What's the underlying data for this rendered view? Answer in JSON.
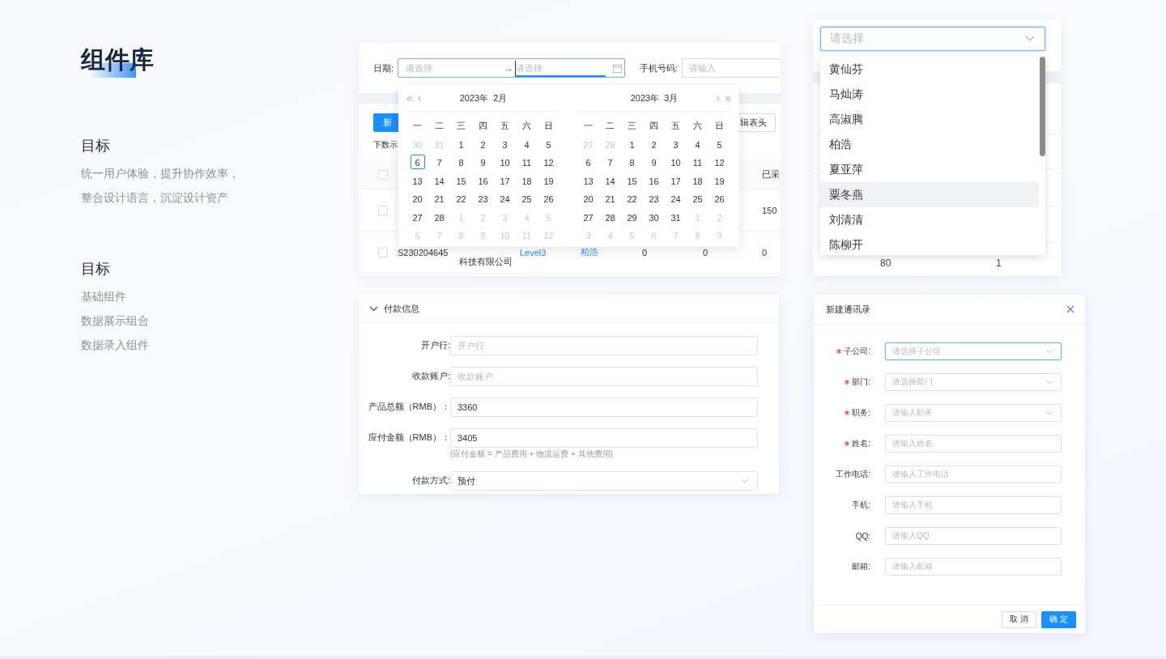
{
  "intro": {
    "title": "组件库",
    "sections": [
      {
        "heading": "目标",
        "lines": [
          "统一用户体验，提升协作效率，",
          "整合设计语言，沉淀设计资产"
        ]
      },
      {
        "heading": "目标",
        "lines": [
          "基础组件",
          "数据展示组合",
          "数据录入组件"
        ]
      }
    ]
  },
  "filter": {
    "date_label": "日期:",
    "start_placeholder": "请选择",
    "separator": "→",
    "end_placeholder": "请选择",
    "phone_label": "手机号码:",
    "phone_placeholder": "请输入"
  },
  "table": {
    "new_button": "新",
    "edit_header_button": "辑表头",
    "caption": "下数示",
    "header_checked": false,
    "columns": [
      "已采"
    ],
    "rows": [
      {
        "checked": false,
        "cells": [
          {
            "text": "150",
            "kind": "text"
          }
        ]
      },
      {
        "checked": false,
        "cells": [
          {
            "text": "S230204645",
            "kind": "text"
          },
          {
            "text": "科技有限公司",
            "kind": "text"
          },
          {
            "text": "Level3",
            "kind": "link"
          },
          {
            "text": "柏浩",
            "kind": "link"
          },
          {
            "text": "0",
            "kind": "text"
          },
          {
            "text": "0",
            "kind": "text"
          },
          {
            "text": "0",
            "kind": "number"
          }
        ]
      }
    ]
  },
  "calendars": [
    {
      "title": "2023年  2月",
      "nav": [
        "«",
        "‹"
      ],
      "weekdays": [
        "一",
        "二",
        "三",
        "四",
        "五",
        "六",
        "日"
      ],
      "weeks": [
        [
          {
            "day": "30",
            "other_month": true,
            "selected": false
          },
          {
            "day": "31",
            "other_month": true,
            "selected": false
          },
          {
            "day": "1",
            "other_month": false,
            "selected": false
          },
          {
            "day": "2",
            "other_month": false,
            "selected": false
          },
          {
            "day": "3",
            "other_month": false,
            "selected": false
          },
          {
            "day": "4",
            "other_month": false,
            "selected": false
          },
          {
            "day": "5",
            "other_month": false,
            "selected": false
          }
        ],
        [
          {
            "day": "6",
            "other_month": false,
            "selected": true
          },
          {
            "day": "7",
            "other_month": false,
            "selected": false
          },
          {
            "day": "8",
            "other_month": false,
            "selected": false
          },
          {
            "day": "9",
            "other_month": false,
            "selected": false
          },
          {
            "day": "10",
            "other_month": false,
            "selected": false
          },
          {
            "day": "11",
            "other_month": false,
            "selected": false
          },
          {
            "day": "12",
            "other_month": false,
            "selected": false
          }
        ],
        [
          {
            "day": "13",
            "other_month": false,
            "selected": false
          },
          {
            "day": "14",
            "other_month": false,
            "selected": false
          },
          {
            "day": "15",
            "other_month": false,
            "selected": false
          },
          {
            "day": "16",
            "other_month": false,
            "selected": false
          },
          {
            "day": "17",
            "other_month": false,
            "selected": false
          },
          {
            "day": "18",
            "other_month": false,
            "selected": false
          },
          {
            "day": "19",
            "other_month": false,
            "selected": false
          }
        ],
        [
          {
            "day": "20",
            "other_month": false,
            "selected": false
          },
          {
            "day": "21",
            "other_month": false,
            "selected": false
          },
          {
            "day": "22",
            "other_month": false,
            "selected": false
          },
          {
            "day": "23",
            "other_month": false,
            "selected": false
          },
          {
            "day": "24",
            "other_month": false,
            "selected": false
          },
          {
            "day": "25",
            "other_month": false,
            "selected": false
          },
          {
            "day": "26",
            "other_month": false,
            "selected": false
          }
        ],
        [
          {
            "day": "27",
            "other_month": false,
            "selected": false
          },
          {
            "day": "28",
            "other_month": false,
            "selected": false
          },
          {
            "day": "1",
            "other_month": true,
            "selected": false
          },
          {
            "day": "2",
            "other_month": true,
            "selected": false
          },
          {
            "day": "3",
            "other_month": true,
            "selected": false
          },
          {
            "day": "4",
            "other_month": true,
            "selected": false
          },
          {
            "day": "5",
            "other_month": true,
            "selected": false
          }
        ],
        [
          {
            "day": "6",
            "other_month": true,
            "selected": false
          },
          {
            "day": "7",
            "other_month": true,
            "selected": false
          },
          {
            "day": "8",
            "other_month": true,
            "selected": false
          },
          {
            "day": "9",
            "other_month": true,
            "selected": false
          },
          {
            "day": "10",
            "other_month": true,
            "selected": false
          },
          {
            "day": "11",
            "other_month": true,
            "selected": false
          },
          {
            "day": "12",
            "other_month": true,
            "selected": false
          }
        ]
      ]
    },
    {
      "title": "2023年  3月",
      "nav": [
        "›",
        "»"
      ],
      "weekdays": [
        "一",
        "二",
        "三",
        "四",
        "五",
        "六",
        "日"
      ],
      "weeks": [
        [
          {
            "day": "27",
            "other_month": true,
            "selected": false
          },
          {
            "day": "28",
            "other_month": true,
            "selected": false
          },
          {
            "day": "1",
            "other_month": false,
            "selected": false
          },
          {
            "day": "2",
            "other_month": false,
            "selected": false
          },
          {
            "day": "3",
            "other_month": false,
            "selected": false
          },
          {
            "day": "4",
            "other_month": false,
            "selected": false
          },
          {
            "day": "5",
            "other_month": false,
            "selected": false
          }
        ],
        [
          {
            "day": "6",
            "other_month": false,
            "selected": false
          },
          {
            "day": "7",
            "other_month": false,
            "selected": false
          },
          {
            "day": "8",
            "other_month": false,
            "selected": false
          },
          {
            "day": "9",
            "other_month": false,
            "selected": false
          },
          {
            "day": "10",
            "other_month": false,
            "selected": false
          },
          {
            "day": "11",
            "other_month": false,
            "selected": false
          },
          {
            "day": "12",
            "other_month": false,
            "selected": false
          }
        ],
        [
          {
            "day": "13",
            "other_month": false,
            "selected": false
          },
          {
            "day": "14",
            "other_month": false,
            "selected": false
          },
          {
            "day": "15",
            "other_month": false,
            "selected": false
          },
          {
            "day": "16",
            "other_month": false,
            "selected": false
          },
          {
            "day": "17",
            "other_month": false,
            "selected": false
          },
          {
            "day": "18",
            "other_month": false,
            "selected": false
          },
          {
            "day": "19",
            "other_month": false,
            "selected": false
          }
        ],
        [
          {
            "day": "20",
            "other_month": false,
            "selected": false
          },
          {
            "day": "21",
            "other_month": false,
            "selected": false
          },
          {
            "day": "22",
            "other_month": false,
            "selected": false
          },
          {
            "day": "23",
            "other_month": false,
            "selected": false
          },
          {
            "day": "24",
            "other_month": false,
            "selected": false
          },
          {
            "day": "25",
            "other_month": false,
            "selected": false
          },
          {
            "day": "26",
            "other_month": false,
            "selected": false
          }
        ],
        [
          {
            "day": "27",
            "other_month": false,
            "selected": false
          },
          {
            "day": "28",
            "other_month": false,
            "selected": false
          },
          {
            "day": "29",
            "other_month": false,
            "selected": false
          },
          {
            "day": "30",
            "other_month": false,
            "selected": false
          },
          {
            "day": "31",
            "other_month": false,
            "selected": false
          },
          {
            "day": "1",
            "other_month": true,
            "selected": false
          },
          {
            "day": "2",
            "other_month": true,
            "selected": false
          }
        ],
        [
          {
            "day": "3",
            "other_month": true,
            "selected": false
          },
          {
            "day": "4",
            "other_month": true,
            "selected": false
          },
          {
            "day": "5",
            "other_month": true,
            "selected": false
          },
          {
            "day": "6",
            "other_month": true,
            "selected": false
          },
          {
            "day": "7",
            "other_month": true,
            "selected": false
          },
          {
            "day": "8",
            "other_month": true,
            "selected": false
          },
          {
            "day": "9",
            "other_month": true,
            "selected": false
          }
        ]
      ]
    }
  ],
  "select": {
    "placeholder": "请选择",
    "options": [
      {
        "label": "黄仙芬",
        "highlighted": false
      },
      {
        "label": "马灿涛",
        "highlighted": false
      },
      {
        "label": "高淑腾",
        "highlighted": false
      },
      {
        "label": "柏浩",
        "highlighted": false
      },
      {
        "label": "夏亚萍",
        "highlighted": false
      },
      {
        "label": "粟冬燕",
        "highlighted": true
      },
      {
        "label": "刘清清",
        "highlighted": false
      },
      {
        "label": "陈柳开",
        "highlighted": false
      }
    ],
    "behind_cells": [
      "80",
      "1"
    ]
  },
  "payment": {
    "title": "付款信息",
    "expanded": true,
    "fields": [
      {
        "label": "开户行:",
        "kind": "input",
        "placeholder": "开户行"
      },
      {
        "label": "收款账户:",
        "kind": "input",
        "placeholder": "收款账户"
      },
      {
        "label": "产品总额（RMB）：",
        "kind": "input",
        "value": "3360"
      },
      {
        "label": "应付金额（RMB）：",
        "kind": "input",
        "value": "3405",
        "hint": "(应付金额 = 产品费用 + 物流运费 + 其他费用)"
      },
      {
        "label": "付款方式:",
        "kind": "select",
        "value": "预付"
      }
    ]
  },
  "dialog": {
    "title": "新建通讯录",
    "fields": [
      {
        "label": "子公司:",
        "required": true,
        "kind": "select",
        "placeholder": "请选择子公司",
        "focused": true
      },
      {
        "label": "部门:",
        "required": true,
        "kind": "select",
        "placeholder": "请选择部门",
        "focused": false
      },
      {
        "label": "职务:",
        "required": true,
        "kind": "select",
        "placeholder": "请输入职务",
        "focused": false
      },
      {
        "label": "姓名:",
        "required": true,
        "kind": "input",
        "placeholder": "请输入姓名",
        "focused": false
      },
      {
        "label": "工作电话:",
        "required": false,
        "kind": "input",
        "placeholder": "请输入工作电话",
        "focused": false
      },
      {
        "label": "手机:",
        "required": false,
        "kind": "input",
        "placeholder": "请输入手机",
        "focused": false
      },
      {
        "label": "QQ:",
        "required": false,
        "kind": "input",
        "placeholder": "请输入QQ",
        "focused": false
      },
      {
        "label": "邮箱:",
        "required": false,
        "kind": "input",
        "placeholder": "请输入邮箱",
        "focused": false
      }
    ],
    "cancel": "取 消",
    "confirm": "确 定"
  }
}
